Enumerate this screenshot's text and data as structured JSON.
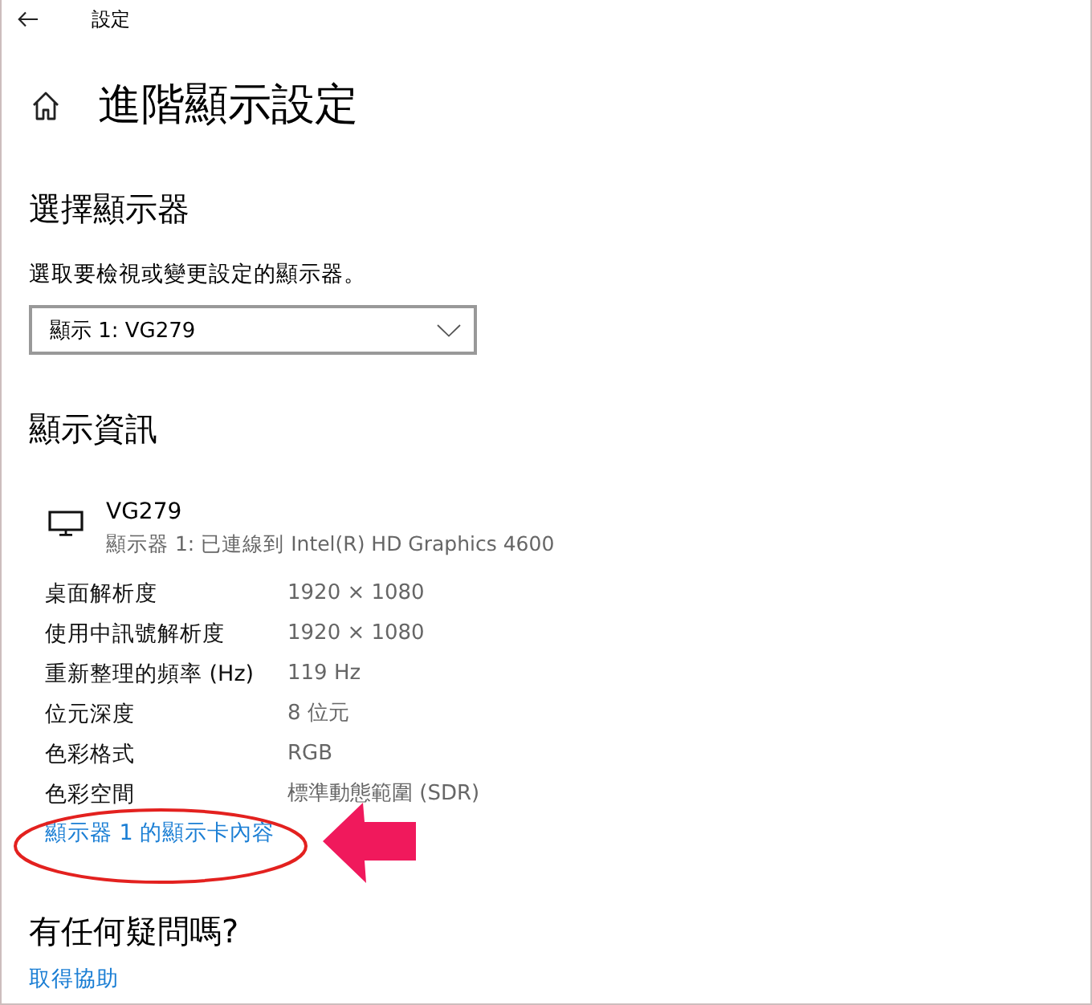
{
  "window": {
    "title": "設定"
  },
  "page": {
    "title": "進階顯示設定"
  },
  "display_select": {
    "heading": "選擇顯示器",
    "description": "選取要檢視或變更設定的顯示器。",
    "dropdown": {
      "value": "顯示 1: VG279"
    }
  },
  "display_info": {
    "heading": "顯示資訊",
    "monitor": {
      "name": "VG279",
      "subtitle": "顯示器 1: 已連線到 Intel(R) HD Graphics 4600"
    },
    "properties": [
      {
        "label": "桌面解析度",
        "value": "1920 × 1080"
      },
      {
        "label": "使用中訊號解析度",
        "value": "1920 × 1080"
      },
      {
        "label": "重新整理的頻率 (Hz)",
        "value": "119 Hz"
      },
      {
        "label": "位元深度",
        "value": "8 位元"
      },
      {
        "label": "色彩格式",
        "value": "RGB"
      },
      {
        "label": "色彩空間",
        "value": "標準動態範圍 (SDR)"
      }
    ],
    "link": "顯示器 1 的顯示卡內容"
  },
  "help": {
    "heading": "有任何疑問嗎?",
    "link": "取得協助"
  }
}
